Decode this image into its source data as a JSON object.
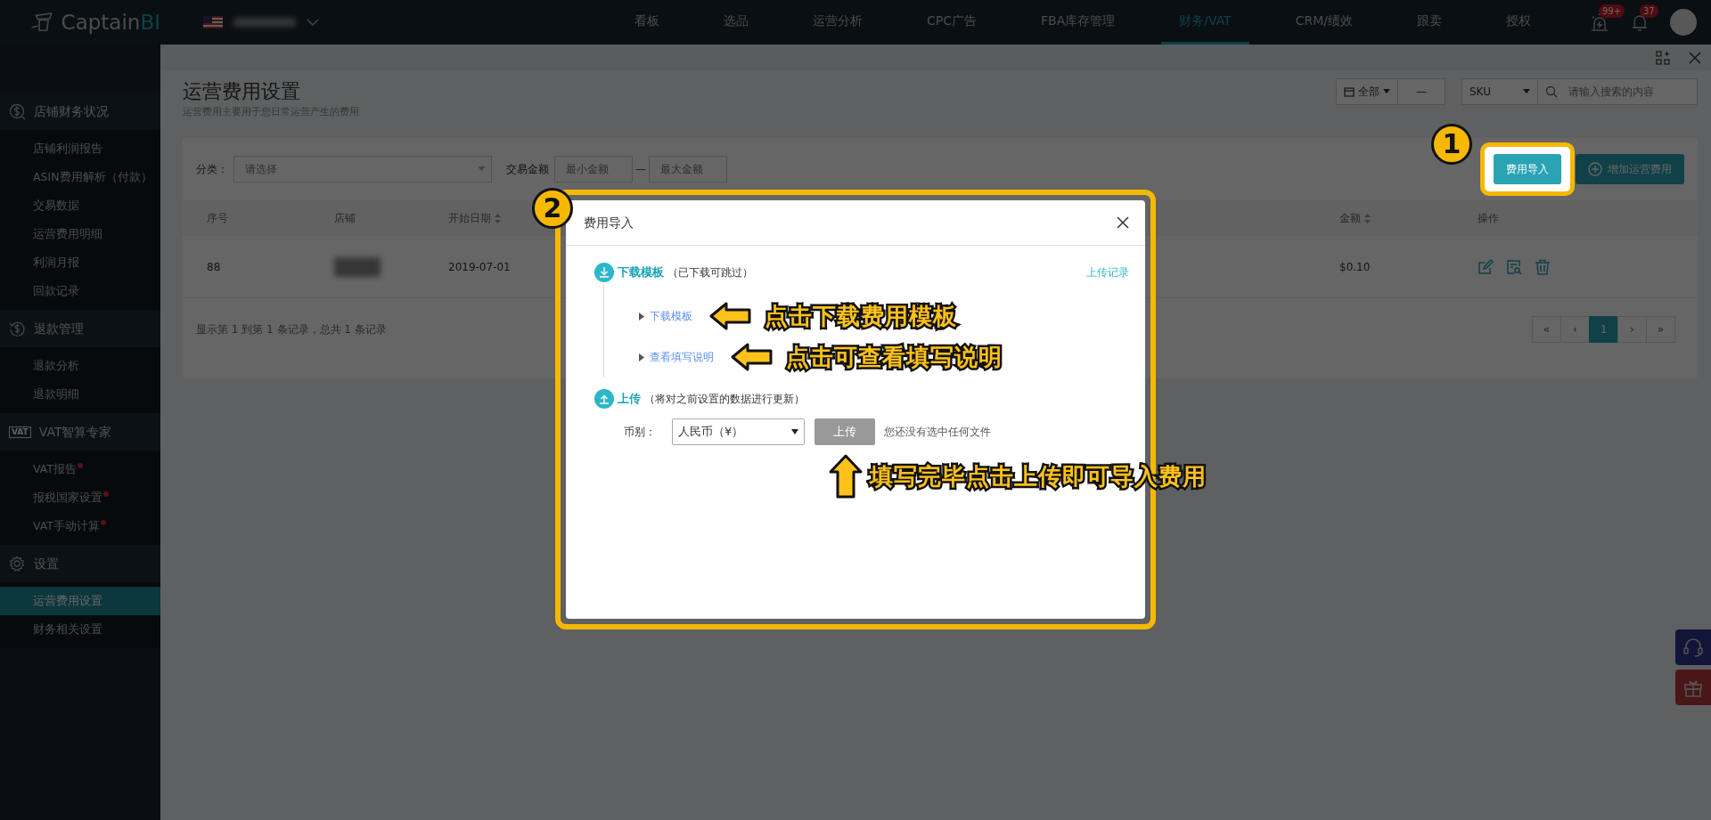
{
  "topbar": {
    "logo": {
      "text": "Captain",
      "accent": "BI"
    },
    "nav": [
      {
        "label": "看板",
        "selected": false
      },
      {
        "label": "选品",
        "selected": false
      },
      {
        "label": "运营分析",
        "selected": false
      },
      {
        "label": "CPC广告",
        "selected": false
      },
      {
        "label": "FBA库存管理",
        "selected": false
      },
      {
        "label": "财务/VAT",
        "selected": true
      },
      {
        "label": "CRM/绩效",
        "selected": false
      },
      {
        "label": "跟卖",
        "selected": false
      },
      {
        "label": "授权",
        "selected": false
      }
    ],
    "alert_badge": "99+",
    "notice_badge": "37"
  },
  "sidebar": [
    {
      "kind": "dollar",
      "title": "店铺财务状况",
      "items": [
        {
          "label": "店铺利润报告",
          "selected": false,
          "dot": false
        },
        {
          "label": "ASIN费用解析（付款）",
          "selected": false,
          "dot": false
        },
        {
          "label": "交易数据",
          "selected": false,
          "dot": false
        },
        {
          "label": "运营费用明细",
          "selected": false,
          "dot": false
        },
        {
          "label": "利润月报",
          "selected": false,
          "dot": false
        },
        {
          "label": "回款记录",
          "selected": false,
          "dot": false
        }
      ]
    },
    {
      "kind": "refund",
      "title": "退款管理",
      "items": [
        {
          "label": "退款分析",
          "selected": false,
          "dot": false
        },
        {
          "label": "退款明细",
          "selected": false,
          "dot": false
        }
      ]
    },
    {
      "kind": "vat",
      "icon_label": "VAT",
      "title": "VAT智算专家",
      "items": [
        {
          "label": "VAT报告",
          "selected": false,
          "dot": true
        },
        {
          "label": "报税国家设置",
          "selected": false,
          "dot": true
        },
        {
          "label": "VAT手动计算",
          "selected": false,
          "dot": true
        }
      ]
    },
    {
      "kind": "gear",
      "title": "设置",
      "items": [
        {
          "label": "运营费用设置",
          "selected": true,
          "dot": false
        },
        {
          "label": "财务相关设置",
          "selected": false,
          "dot": false
        }
      ]
    }
  ],
  "page": {
    "title": "运营费用设置",
    "subtitle": "运营费用主要用于您日常运营产生的费用",
    "date_filter": "全部",
    "dash_button": "—",
    "sku_select": "SKU",
    "search": {
      "placeholder": "请输入搜索的内容"
    }
  },
  "filters": {
    "category_label": "分类：",
    "category": {
      "placeholder": "请选择"
    },
    "amount_label": "交易金额",
    "min": {
      "placeholder": "最小金额"
    },
    "separator": "—",
    "max": {
      "placeholder": "最大金额"
    }
  },
  "actions": [
    {
      "label": "费用导入",
      "highlighted": true,
      "step": "1"
    },
    {
      "label": "增加运营费用",
      "highlighted": false
    }
  ],
  "table": {
    "columns": [
      {
        "label": "序号",
        "sortable": false
      },
      {
        "label": "店铺",
        "sortable": false
      },
      {
        "label": "开始日期",
        "sortable": true
      },
      {
        "label": "金额",
        "sortable": true
      },
      {
        "label": "操作",
        "sortable": false
      }
    ],
    "rows": [
      {
        "index": "88",
        "start_date": "2019-07-01",
        "amount": "$0.10"
      }
    ]
  },
  "pagination": {
    "summary": "显示第 1 到第 1 条记录，总共 1 条记录",
    "pages": [
      {
        "label": "«",
        "selected": false
      },
      {
        "label": "‹",
        "selected": false
      },
      {
        "label": "1",
        "selected": true
      },
      {
        "label": "›",
        "selected": false
      },
      {
        "label": "»",
        "selected": false
      }
    ]
  },
  "modal": {
    "step_marker": "2",
    "title": "费用导入",
    "history_link": "上传记录",
    "steps": [
      {
        "kind": "download",
        "title": "下载模板",
        "note": "（已下载可跳过）"
      },
      {
        "kind": "upload",
        "title": "上传",
        "note": "（将对之前设置的数据进行更新）"
      }
    ],
    "links": [
      {
        "label": "下载模板",
        "annotation": "点击下载费用模板"
      },
      {
        "label": "查看填写说明",
        "annotation": "点击可查看填写说明"
      }
    ],
    "currency_label": "币别：",
    "currency": "人民币（¥）",
    "upload_button": "上传",
    "file_status": "您还没有选中任何文件",
    "upload_annotation": "填写完毕点击上传即可导入费用"
  }
}
